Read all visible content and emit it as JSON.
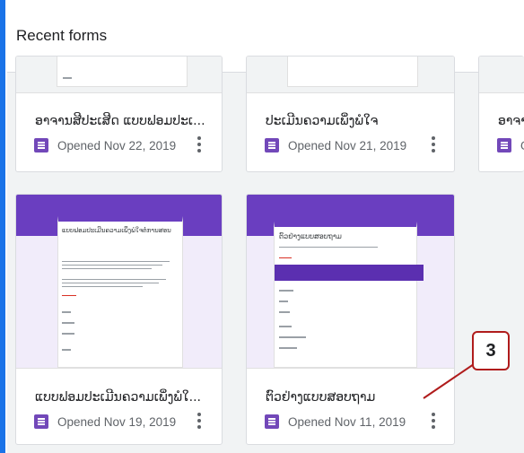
{
  "header": {
    "title": "Recent forms"
  },
  "cards": [
    {
      "title": "ອາຈານສີປະເສີດ ແບບຟອມປະເ...",
      "opened": "Opened Nov 22, 2019"
    },
    {
      "title": "ປະເມີນຄວາມເພິ່ງພໍໃຈ",
      "opened": "Opened Nov 21, 2019"
    },
    {
      "title": "ອາຈາ",
      "opened": "O"
    },
    {
      "title": "ແບບຟອມປະເມີນຄວາມເພິ່ງພໍໃ...",
      "opened": "Opened Nov 19, 2019",
      "preview_title": "ແບບຟອມປະເມີນຄວາມເພິ່ງພໍໃຈຕໍ່ການສອນ"
    },
    {
      "title": "ຕົວຢ່າງແບບສອບຖາມ",
      "opened": "Opened Nov 11, 2019",
      "preview_title": "ຕົວຢ່າງແບບສອບຖາມ"
    }
  ],
  "callout": {
    "number": "3"
  },
  "colors": {
    "forms_purple": "#7248b9",
    "callout_border": "#b01c1c",
    "frame_blue": "#1a73e8"
  }
}
